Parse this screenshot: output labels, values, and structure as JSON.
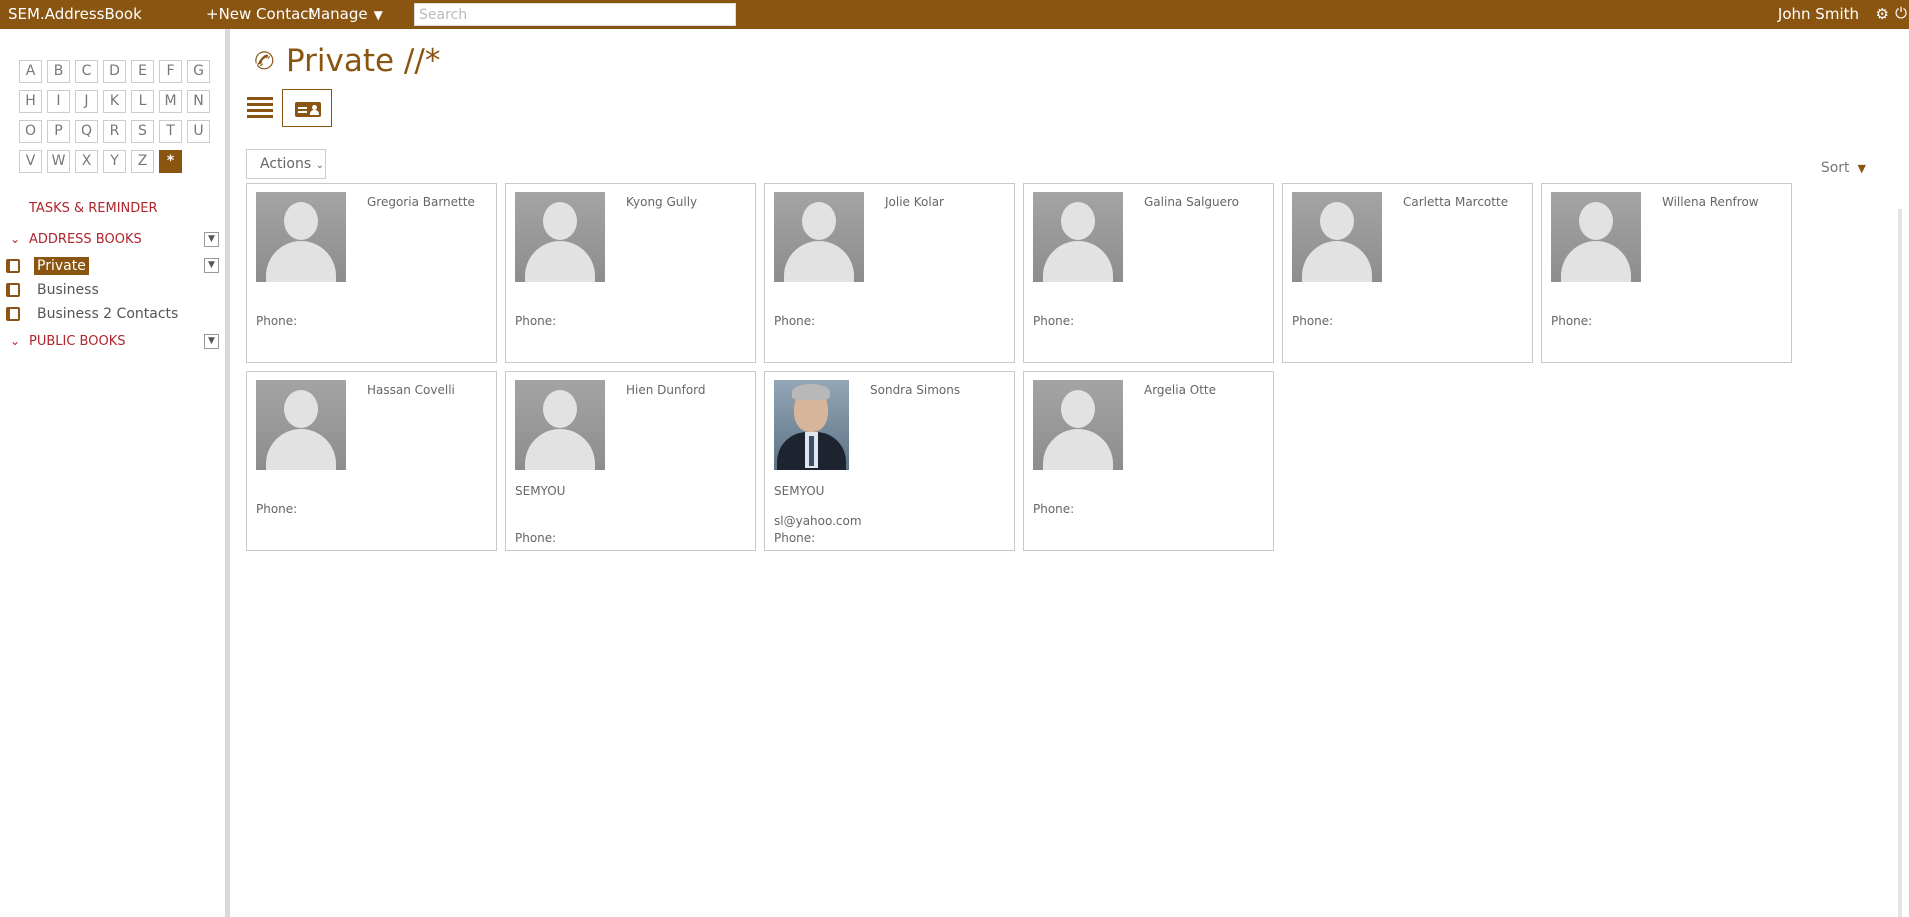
{
  "topbar": {
    "brand": "SEM.AddressBook",
    "new_contact": "+New Contact",
    "manage": "Manage",
    "search_placeholder": "Search",
    "user": "John Smith"
  },
  "sidebar": {
    "letters": [
      "A",
      "B",
      "C",
      "D",
      "E",
      "F",
      "G",
      "H",
      "I",
      "J",
      "K",
      "L",
      "M",
      "N",
      "O",
      "P",
      "Q",
      "R",
      "S",
      "T",
      "U",
      "V",
      "W",
      "X",
      "Y",
      "Z",
      "*"
    ],
    "selected_letter": "*",
    "tasks_label": "TASKS & REMINDER",
    "address_books_label": "ADDRESS BOOKS",
    "books": [
      {
        "label": "Private",
        "active": true
      },
      {
        "label": "Business",
        "active": false
      },
      {
        "label": "Business 2 Contacts",
        "active": false
      }
    ],
    "public_books_label": "PUBLIC BOOKS"
  },
  "main": {
    "title": "Private //*",
    "actions_label": "Actions",
    "sort_label": "Sort",
    "phone_label": "Phone:",
    "contacts": [
      {
        "name": "Gregoria Barnette",
        "company": "",
        "email": "",
        "photo": "placeholder"
      },
      {
        "name": "Kyong Gully",
        "company": "",
        "email": "",
        "photo": "placeholder"
      },
      {
        "name": "Jolie Kolar",
        "company": "",
        "email": "",
        "photo": "placeholder"
      },
      {
        "name": "Galina Salguero",
        "company": "",
        "email": "",
        "photo": "placeholder"
      },
      {
        "name": "Carletta Marcotte",
        "company": "",
        "email": "",
        "photo": "placeholder"
      },
      {
        "name": "Willena Renfrow",
        "company": "",
        "email": "",
        "photo": "placeholder"
      },
      {
        "name": "Hassan Covelli",
        "company": "",
        "email": "",
        "photo": "placeholder"
      },
      {
        "name": "Hien Dunford",
        "company": "SEMYOU",
        "email": "",
        "photo": "placeholder"
      },
      {
        "name": "Sondra Simons",
        "company": "SEMYOU",
        "email": "sl@yahoo.com",
        "photo": "photo"
      },
      {
        "name": "Argelia Otte",
        "company": "",
        "email": "",
        "photo": "placeholder"
      }
    ]
  },
  "colors": {
    "accent": "#8a5511",
    "section_red": "#b0242b"
  },
  "icons": {
    "title": "phone-icon",
    "list_view": "list-view-icon",
    "card_view": "card-view-icon",
    "settings": "gear-icon",
    "power": "power-icon"
  }
}
